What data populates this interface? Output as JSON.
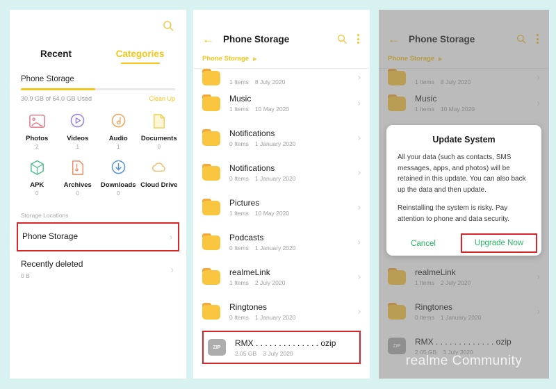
{
  "background_color": "#d7f2f0",
  "accent_yellow": "#f5c518",
  "highlight_red": "#d6262a",
  "dialog_green": "#28b765",
  "panel1": {
    "search_icon": "search-icon",
    "tabs": [
      {
        "label": "Recent",
        "state": "inactive"
      },
      {
        "label": "Categories",
        "state": "active"
      }
    ],
    "storage": {
      "title": "Phone Storage",
      "used_text": "30.9 GB of 64.0 GB Used",
      "cleanup_label": "Clean Up",
      "percent": 48
    },
    "categories": [
      {
        "label": "Photos",
        "count": "2",
        "icon": "photos-icon"
      },
      {
        "label": "Videos",
        "count": "1",
        "icon": "videos-icon"
      },
      {
        "label": "Audio",
        "count": "1",
        "icon": "audio-icon"
      },
      {
        "label": "Documents",
        "count": "0",
        "icon": "documents-icon"
      },
      {
        "label": "APK",
        "count": "0",
        "icon": "apk-icon"
      },
      {
        "label": "Archives",
        "count": "0",
        "icon": "archives-icon"
      },
      {
        "label": "Downloads",
        "count": "0",
        "icon": "downloads-icon"
      },
      {
        "label": "Cloud Drive",
        "count": "",
        "icon": "cloud-drive-icon"
      }
    ],
    "storage_locations_label": "Storage Locations",
    "locations": [
      {
        "name": "Phone Storage",
        "sub": "",
        "highlighted": true
      },
      {
        "name": "Recently deleted",
        "sub": "0 B",
        "highlighted": false
      }
    ]
  },
  "panel2": {
    "back_icon": "back-arrow-icon",
    "title": "Phone Storage",
    "search_icon": "search-icon",
    "menu_icon": "overflow-menu-icon",
    "breadcrumb": "Phone Storage",
    "files": [
      {
        "name": "",
        "items": "1 Items",
        "date": "8 July 2020",
        "type": "folder",
        "clipped": true
      },
      {
        "name": "Music",
        "items": "1 Items",
        "date": "10 May 2020",
        "type": "folder"
      },
      {
        "name": "Notifications",
        "items": "0 Items",
        "date": "1 January 2020",
        "type": "folder"
      },
      {
        "name": "Notifications",
        "items": "0 Items",
        "date": "1 January 2020",
        "type": "folder"
      },
      {
        "name": "Pictures",
        "items": "1 Items",
        "date": "10 May 2020",
        "type": "folder"
      },
      {
        "name": "Podcasts",
        "items": "0 Items",
        "date": "1 January 2020",
        "type": "folder"
      },
      {
        "name": "realmeLink",
        "items": "1 Items",
        "date": "2 July 2020",
        "type": "folder"
      },
      {
        "name": "Ringtones",
        "items": "0 Items",
        "date": "1 January 2020",
        "type": "folder"
      },
      {
        "name": "RMX . . . . . . . . . . . . . . ozip",
        "items": "2.05 GB",
        "date": "3 July 2020",
        "type": "zip",
        "badge": "ZIP",
        "highlighted": true
      }
    ]
  },
  "panel3": {
    "back_icon": "back-arrow-icon",
    "title": "Phone Storage",
    "search_icon": "search-icon",
    "menu_icon": "overflow-menu-icon",
    "breadcrumb": "Phone Storage",
    "files": [
      {
        "name": "",
        "items": "1 Items",
        "date": "8 July 2020",
        "type": "folder",
        "clipped": true
      },
      {
        "name": "Music",
        "items": "1 Items",
        "date": "10 May 2020",
        "type": "folder"
      },
      {
        "name": "Notifications",
        "items": "0 Items",
        "date": "1 January 2020",
        "type": "folder"
      },
      {
        "name": "Notifications",
        "items": "0 Items",
        "date": "1 January 2020",
        "type": "folder"
      },
      {
        "name": "Pictures",
        "items": "1 Items",
        "date": "10 May 2020",
        "type": "folder"
      },
      {
        "name": "Podcasts",
        "items": "0 Items",
        "date": "1 January 2020",
        "type": "folder"
      },
      {
        "name": "realmeLink",
        "items": "1 Items",
        "date": "2 July 2020",
        "type": "folder"
      },
      {
        "name": "Ringtones",
        "items": "0 Items",
        "date": "1 January 2020",
        "type": "folder"
      },
      {
        "name": "RMX . . . . . . . . . . . . . ozip",
        "items": "2.05 GB",
        "date": "3 July 2020",
        "type": "zip",
        "badge": "ZIP"
      }
    ],
    "dialog": {
      "title": "Update System",
      "paragraph1": "All your data (such as contacts, SMS messages, apps, and photos) will be retained in this update. You can also back up the data and then update.",
      "paragraph2": "Reinstalling the system is risky. Pay attention to phone and data security.",
      "cancel_label": "Cancel",
      "confirm_label": "Upgrade Now"
    },
    "watermark_brand": "realme",
    "watermark_text": "Community"
  }
}
